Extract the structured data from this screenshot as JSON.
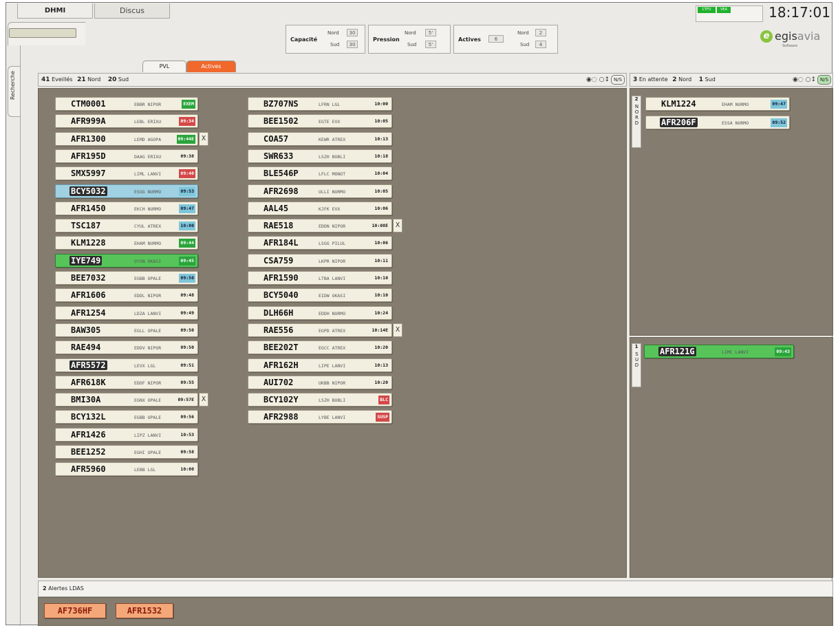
{
  "top": {
    "tabs": [
      "DHMI",
      "Discus"
    ],
    "clock": "18:17:01",
    "leds": [
      "CTFU",
      "VEA"
    ],
    "search_tab": "Recherche"
  },
  "counters": {
    "capacite": {
      "label": "Capacité",
      "nord_label": "Nord",
      "nord": "30",
      "sud_label": "Sud",
      "sud": "30"
    },
    "pression": {
      "label": "Pression",
      "nord_label": "Nord",
      "nord": "5'",
      "sud_label": "Sud",
      "sud": "5'"
    },
    "actives": {
      "label": "Actives",
      "value": "6",
      "nord_label": "Nord",
      "nord": "2",
      "sud_label": "Sud",
      "sud": "4"
    }
  },
  "logo": {
    "name": "egis",
    "suffix": "avia",
    "tagline": "Software"
  },
  "subtabs": [
    "PVL",
    "Actives"
  ],
  "left_panel": {
    "count_eveilles": "41",
    "label_eveilles": "Eveillés",
    "count_nord": "21",
    "label_nord": "Nord",
    "count_sud": "20",
    "label_sud": "Sud",
    "ns_button": "N/S"
  },
  "right_panel": {
    "count_attente": "3",
    "label_attente": "En attente",
    "count_nord": "2",
    "label_nord": "Nord",
    "count_sud": "1",
    "label_sud": "Sud",
    "ns_button": "N/S",
    "nord_label": "NORD",
    "nord_count": "2",
    "sud_label": "SUD",
    "sud_count": "1"
  },
  "strips_col1": [
    {
      "cs": "CTM0001",
      "ad": "EBBR NIPOR",
      "tag": "EXEM",
      "tagc": "green"
    },
    {
      "cs": "AFR999A",
      "ad": "LEBL ERIXU",
      "tag": "09:34",
      "tagc": "red"
    },
    {
      "cs": "AFR1300",
      "ad": "LEMD AGOPA",
      "tag": "09:44E",
      "tagc": "green",
      "ext": "X"
    },
    {
      "cs": "AFR195D",
      "ad": "DAAG ERIXU",
      "tag": "09:38",
      "tagc": "plain"
    },
    {
      "cs": "SMX5997",
      "ad": "LIML LANVI",
      "tag": "09:40",
      "tagc": "red"
    },
    {
      "cs": "BCY5032",
      "ad": "ESGG NURMO",
      "tag": "09:53",
      "tagc": "blue",
      "row": "blue",
      "hl": true
    },
    {
      "cs": "AFR1450",
      "ad": "EKCH NURMO",
      "tag": "09:47",
      "tagc": "blue"
    },
    {
      "cs": "TSC187",
      "ad": "CYUL ATREX",
      "tag": "10:00",
      "tagc": "blue"
    },
    {
      "cs": "KLM1228",
      "ad": "EHAM NURMO",
      "tag": "09:44",
      "tagc": "green"
    },
    {
      "cs": "IYE749",
      "ad": "OYSN OKASI",
      "tag": "09:45",
      "tagc": "green",
      "row": "green",
      "hl": true
    },
    {
      "cs": "BEE7032",
      "ad": "EGBB OPALE",
      "tag": "09:50",
      "tagc": "blue"
    },
    {
      "cs": "AFR1606",
      "ad": "EDDL NIPOR",
      "tag": "09:48",
      "tagc": "plain"
    },
    {
      "cs": "AFR1254",
      "ad": "LDZA LANVI",
      "tag": "09:49",
      "tagc": "plain"
    },
    {
      "cs": "BAW305",
      "ad": "EGLL OPALE",
      "tag": "09:50",
      "tagc": "plain"
    },
    {
      "cs": "RAE494",
      "ad": "EDDV NIPOR",
      "tag": "09:50",
      "tagc": "plain"
    },
    {
      "cs": "AFR5572",
      "ad": "LEVX LGL",
      "tag": "09:51",
      "tagc": "plain",
      "hl": true
    },
    {
      "cs": "AFR618K",
      "ad": "EDDF NIPOR",
      "tag": "09:55",
      "tagc": "plain"
    },
    {
      "cs": "BMI30A",
      "ad": "EGNX OPALE",
      "tag": "09:57E",
      "tagc": "plain",
      "ext": "X"
    },
    {
      "cs": "BCY132L",
      "ad": "EGBB OPALE",
      "tag": "09:56",
      "tagc": "plain"
    },
    {
      "cs": "AFR1426",
      "ad": "LIPZ LANVI",
      "tag": "10:53",
      "tagc": "plain"
    },
    {
      "cs": "BEE1252",
      "ad": "EGHI OPALE",
      "tag": "09:58",
      "tagc": "plain"
    },
    {
      "cs": "AFR5960",
      "ad": "LEBB LGL",
      "tag": "10:00",
      "tagc": "plain"
    }
  ],
  "strips_col2": [
    {
      "cs": "BZ707NS",
      "ad": "LFRN LGL",
      "tag": "10:00",
      "tagc": "plain"
    },
    {
      "cs": "BEE1502",
      "ad": "EGTE EVX",
      "tag": "10:05",
      "tagc": "plain"
    },
    {
      "cs": "COA57",
      "ad": "KEWR ATREX",
      "tag": "10:13",
      "tagc": "plain"
    },
    {
      "cs": "SWR633",
      "ad": "LSZH BUBLI",
      "tag": "10:18",
      "tagc": "plain"
    },
    {
      "cs": "BLE546P",
      "ad": "LFLC MONOT",
      "tag": "10:04",
      "tagc": "plain"
    },
    {
      "cs": "AFR2698",
      "ad": "ULLI NURMO",
      "tag": "10:05",
      "tagc": "plain"
    },
    {
      "cs": "AAL45",
      "ad": "KJFK EVX",
      "tag": "10:06",
      "tagc": "plain"
    },
    {
      "cs": "RAE518",
      "ad": "EDDN NIPOR",
      "tag": "10:08E",
      "tagc": "plain",
      "ext": "X"
    },
    {
      "cs": "AFR184L",
      "ad": "LSGG PILUL",
      "tag": "10:06",
      "tagc": "plain"
    },
    {
      "cs": "CSA759",
      "ad": "LKPR NIPOR",
      "tag": "10:11",
      "tagc": "plain"
    },
    {
      "cs": "AFR1590",
      "ad": "LTBA LANVI",
      "tag": "10:10",
      "tagc": "plain"
    },
    {
      "cs": "BCY5040",
      "ad": "EIDW OKASI",
      "tag": "10:10",
      "tagc": "plain"
    },
    {
      "cs": "DLH66H",
      "ad": "EDDH NURMO",
      "tag": "10:24",
      "tagc": "plain"
    },
    {
      "cs": "RAE556",
      "ad": "EGPD ATREX",
      "tag": "10:14E",
      "tagc": "plain",
      "ext": "X"
    },
    {
      "cs": "BEE202T",
      "ad": "EGCC ATREX",
      "tag": "10:20",
      "tagc": "plain"
    },
    {
      "cs": "AFR162H",
      "ad": "LIPE LANVI",
      "tag": "10:13",
      "tagc": "plain"
    },
    {
      "cs": "AUI702",
      "ad": "UKBB NIPOR",
      "tag": "10:20",
      "tagc": "plain"
    },
    {
      "cs": "BCY102Y",
      "ad": "LSZH BUBLI",
      "tag": "BLC",
      "tagc": "red"
    },
    {
      "cs": "AFR2988",
      "ad": "LYBE LANVI",
      "tag": "SUSP",
      "tagc": "red"
    }
  ],
  "strips_nord": [
    {
      "cs": "KLM1224",
      "ad": "EHAM NURMO",
      "tag": "09:47",
      "tagc": "blue"
    },
    {
      "cs": "AFR206F",
      "ad": "ESSA NURMO",
      "tag": "09:52",
      "tagc": "blue",
      "hl": true
    }
  ],
  "strips_sud": [
    {
      "cs": "AFR121G",
      "ad": "LIMC LANVI",
      "tag": "09:43",
      "tagc": "green",
      "row": "green",
      "hl": true
    }
  ],
  "alerts": {
    "count": "2",
    "label": "Alertes LDAS",
    "items": [
      "AF736HF",
      "AFR1532"
    ]
  },
  "colors": {
    "panel_bg": "#857c70",
    "strip_bg": "#f2efe1",
    "green": "#2aa53c",
    "red": "#d44848",
    "blue": "#7fc6d9",
    "orange": "#f1682c",
    "alert": "#f4a87a"
  }
}
